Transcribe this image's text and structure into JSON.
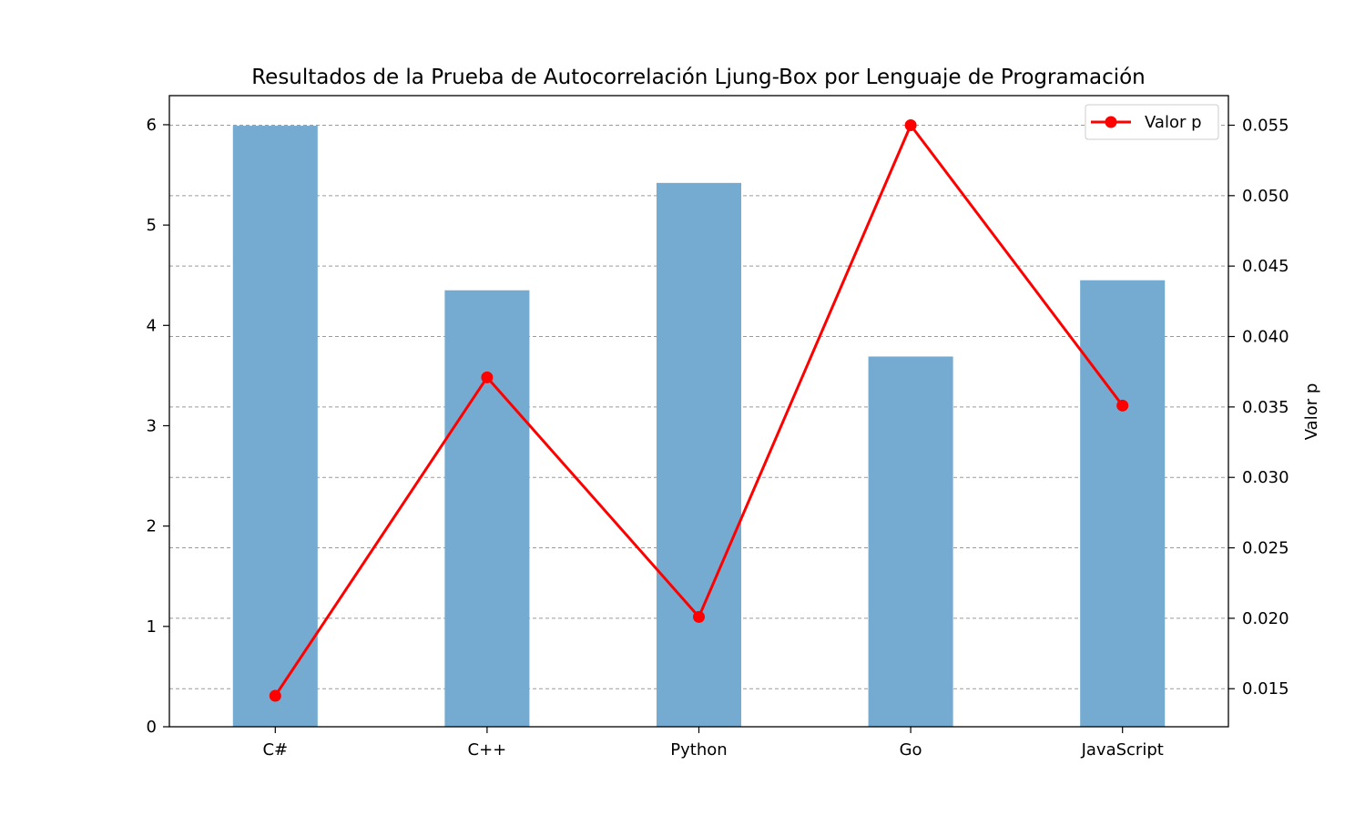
{
  "chart_data": {
    "type": "bar+line",
    "title": "Resultados de la Prueba de Autocorrelación Ljung-Box por Lenguaje de Programación",
    "categories": [
      "C#",
      "C++",
      "Python",
      "Go",
      "JavaScript"
    ],
    "series": [
      {
        "axis": "left",
        "kind": "bar",
        "values": [
          5.99,
          4.35,
          5.42,
          3.69,
          4.45
        ],
        "color": "#75abd1"
      },
      {
        "name": "Valor p",
        "axis": "right",
        "kind": "line",
        "values": [
          0.0145,
          0.0371,
          0.0201,
          0.055,
          0.0351
        ],
        "color": "#ff0000"
      }
    ],
    "ylabel_left": "",
    "ylabel_right": "Valor p",
    "ylim_left": [
      0,
      6.29
    ],
    "yticks_left": [
      "0",
      "1",
      "2",
      "3",
      "4",
      "5",
      "6"
    ],
    "ylim_right": [
      0.0123,
      0.0571
    ],
    "yticks_right": [
      "0.015",
      "0.020",
      "0.025",
      "0.030",
      "0.035",
      "0.040",
      "0.045",
      "0.050",
      "0.055"
    ],
    "grid": "horizontal dashed on right axis ticks",
    "legend": {
      "position": "top-right",
      "entries": [
        "Valor p"
      ]
    }
  }
}
